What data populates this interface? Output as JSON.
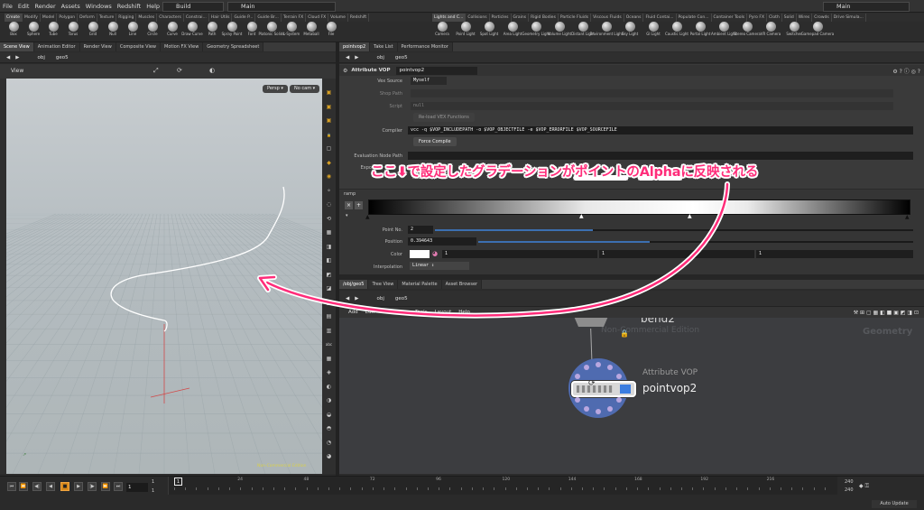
{
  "menubar": {
    "items": [
      "File",
      "Edit",
      "Render",
      "Assets",
      "Windows",
      "Redshift",
      "Help"
    ],
    "desktop": "Build",
    "context": "Main",
    "right_context": "Main"
  },
  "shelf_left": {
    "tabs": [
      "Create",
      "Modify",
      "Model",
      "Polygon",
      "Deform",
      "Texture",
      "Rigging",
      "Muscles",
      "Characters",
      "Constrai...",
      "Hair Utils",
      "Guide P...",
      "Guide Br...",
      "Terrain FX",
      "Cloud FX",
      "Volume",
      "Redshift"
    ],
    "tools": [
      "Box",
      "Sphere",
      "Tube",
      "Torus",
      "Grid",
      "Null",
      "Line",
      "Circle",
      "Curve",
      "Draw Curve",
      "Path",
      "Spray Paint",
      "Font",
      "Platonic Solids",
      "L-System",
      "Metaball",
      "File"
    ]
  },
  "shelf_right": {
    "tabs": [
      "Lights and C...",
      "Collisions",
      "Particles",
      "Grains",
      "Rigid Bodies",
      "Particle Fluids",
      "Viscous Fluids",
      "Oceans",
      "Fluid Contai...",
      "Populate Con...",
      "Container Tools",
      "Pyro FX",
      "Cloth",
      "Solid",
      "Wires",
      "Crowds",
      "Drive Simula..."
    ],
    "tools": [
      "Camera",
      "Point Light",
      "Spot Light",
      "Area Light",
      "Geometry Light",
      "Volume Light",
      "Distant Light",
      "Environment Light",
      "Sky Light",
      "GI Light",
      "Caustic Light",
      "Portal Light",
      "Ambient Light",
      "Stereo Camera",
      "VR Camera",
      "Switcher",
      "Gamepad Camera"
    ]
  },
  "left_pane": {
    "tabs": [
      "Scene View",
      "Animation Editor",
      "Render View",
      "Composite View",
      "Motion FX View",
      "Geometry Spreadsheet"
    ],
    "path": [
      "obj",
      "geo5"
    ],
    "viewport_title": "View",
    "persp": "Persp",
    "cam": "No cam",
    "watermark": "Non-Commercial Edition"
  },
  "right_top_pane": {
    "tabs": [
      "pointvop2",
      "Take List",
      "Performance Monitor"
    ],
    "path": [
      "obj",
      "geo5"
    ],
    "node_type": "Attribute VOP",
    "node_name": "pointvop2",
    "params": {
      "vex_source_label": "Vex Source",
      "vex_source_value": "Myself",
      "shop_path_label": "Shop Path",
      "script_label": "Script",
      "script_value": "null",
      "reload_label": "Re-load VEX Functions",
      "compiler_label": "Compiler",
      "compiler_value": "vcc -q $VOP_INCLUDEPATH -o $VOP_OBJECTFILE -e $VOP_ERRORFILE $VOP_SOURCEFILE",
      "force_compile": "Force Compile",
      "eval_node_label": "Evaluation Node Path",
      "export_label": "Export",
      "enable_label": "Enable",
      "ramp_label": "ramp",
      "point_no_label": "Point No.",
      "point_no_value": "2",
      "position_label": "Position",
      "position_value": "0.394643",
      "color_label": "Color",
      "color_r": "1",
      "color_g": "1",
      "color_b": "1",
      "interp_label": "Interpolation",
      "interp_value": "Linear"
    }
  },
  "right_bottom_pane": {
    "tabs": [
      "/obj/geo5",
      "Tree View",
      "Material Palette",
      "Asset Browser"
    ],
    "path": [
      "obj",
      "geo5"
    ],
    "menu": [
      "Add",
      "Edit",
      "Go",
      "View",
      "Tools",
      "Layout",
      "Help"
    ],
    "watermark": "Non-Commercial Edition",
    "context_label": "Geometry",
    "node_above": "bend2",
    "node_type": "Attribute VOP",
    "node_name": "pointvop2"
  },
  "timeline": {
    "current_frame": "1",
    "start": "1",
    "start2": "1",
    "end": "240",
    "end2": "240",
    "ticks": [
      "1",
      "24",
      "48",
      "72",
      "96",
      "120",
      "144",
      "168",
      "192",
      "216"
    ],
    "auto_update": "Auto Update"
  },
  "annotation": {
    "text_before": "ここ⬇で設定したグラデーションが",
    "text_ul1": "ポイント",
    "text_mid": "の",
    "text_ul2": "Alpha",
    "text_after": "に反映される",
    "color": "#ff2d7a"
  }
}
